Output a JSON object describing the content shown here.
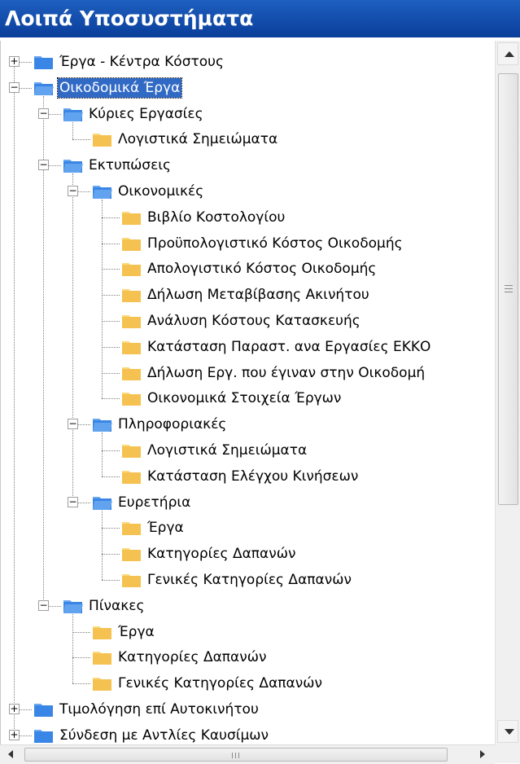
{
  "panel": {
    "title": "Λοιπά Υποσυστήματα"
  },
  "tree": [
    {
      "label": "Έργα - Κέντρα Κόστους",
      "depth": 0,
      "expander": "+",
      "open": false,
      "selected": false
    },
    {
      "label": "Οικοδομικά Έργα",
      "depth": 0,
      "expander": "−",
      "open": true,
      "selected": true
    },
    {
      "label": "Κύριες Εργασίες",
      "depth": 1,
      "expander": "−",
      "open": true,
      "selected": false
    },
    {
      "label": "Λογιστικά Σημειώματα",
      "depth": 2,
      "expander": null,
      "open": false,
      "selected": false
    },
    {
      "label": "Εκτυπώσεις",
      "depth": 1,
      "expander": "−",
      "open": true,
      "selected": false
    },
    {
      "label": "Οικονομικές",
      "depth": 2,
      "expander": "−",
      "open": true,
      "selected": false
    },
    {
      "label": "Βιβλίο Κοστολογίου",
      "depth": 3,
      "expander": null,
      "open": false,
      "selected": false
    },
    {
      "label": "Προϋπολογιστικό Κόστος Οικοδομής",
      "depth": 3,
      "expander": null,
      "open": false,
      "selected": false
    },
    {
      "label": "Απολογιστικό Κόστος Οικοδομής",
      "depth": 3,
      "expander": null,
      "open": false,
      "selected": false
    },
    {
      "label": "Δήλωση Μεταβίβασης Ακινήτου",
      "depth": 3,
      "expander": null,
      "open": false,
      "selected": false
    },
    {
      "label": "Ανάλυση Κόστους Κατασκευής",
      "depth": 3,
      "expander": null,
      "open": false,
      "selected": false
    },
    {
      "label": "Κατάσταση Παραστ. ανα Εργασίες ΕΚΚΟ",
      "depth": 3,
      "expander": null,
      "open": false,
      "selected": false
    },
    {
      "label": "Δήλωση Εργ. που έγιναν στην Οικοδομή",
      "depth": 3,
      "expander": null,
      "open": false,
      "selected": false
    },
    {
      "label": "Οικονομικά Στοιχεία Έργων",
      "depth": 3,
      "expander": null,
      "open": false,
      "selected": false
    },
    {
      "label": "Πληροφοριακές",
      "depth": 2,
      "expander": "−",
      "open": true,
      "selected": false
    },
    {
      "label": "Λογιστικά Σημειώματα",
      "depth": 3,
      "expander": null,
      "open": false,
      "selected": false
    },
    {
      "label": "Κατάσταση Ελέγχου Κινήσεων",
      "depth": 3,
      "expander": null,
      "open": false,
      "selected": false
    },
    {
      "label": "Ευρετήρια",
      "depth": 2,
      "expander": "−",
      "open": true,
      "selected": false
    },
    {
      "label": "Έργα",
      "depth": 3,
      "expander": null,
      "open": false,
      "selected": false
    },
    {
      "label": "Κατηγορίες Δαπανών",
      "depth": 3,
      "expander": null,
      "open": false,
      "selected": false
    },
    {
      "label": "Γενικές Κατηγορίες Δαπανών",
      "depth": 3,
      "expander": null,
      "open": false,
      "selected": false
    },
    {
      "label": "Πίνακες",
      "depth": 1,
      "expander": "−",
      "open": true,
      "selected": false
    },
    {
      "label": "Έργα",
      "depth": 2,
      "expander": null,
      "open": false,
      "selected": false
    },
    {
      "label": "Κατηγορίες Δαπανών",
      "depth": 2,
      "expander": null,
      "open": false,
      "selected": false
    },
    {
      "label": "Γενικές Κατηγορίες Δαπανών",
      "depth": 2,
      "expander": null,
      "open": false,
      "selected": false
    },
    {
      "label": "Τιμολόγηση επί Αυτοκινήτου",
      "depth": 0,
      "expander": "+",
      "open": false,
      "selected": false
    },
    {
      "label": "Σύνδεση με Αντλίες Καυσίμων",
      "depth": 0,
      "expander": "+",
      "open": false,
      "selected": false
    }
  ],
  "colors": {
    "header": "#0a3e9a",
    "selection": "#316ac5",
    "folder_open": "#f5c251",
    "folder_blue": "#2d7fe0"
  },
  "icons": {
    "folder": "folder-icon",
    "folder_open": "folder-open-icon",
    "expand": "plus-box-icon",
    "collapse": "minus-box-icon"
  }
}
